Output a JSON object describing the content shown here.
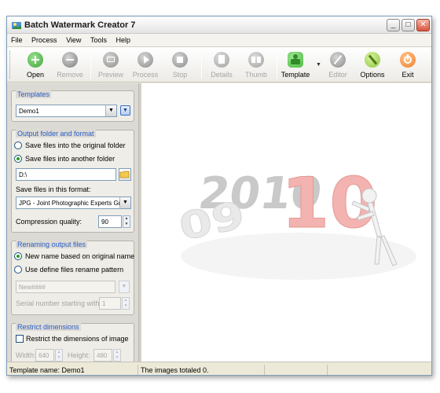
{
  "window": {
    "title": "Batch Watermark Creator 7",
    "controls": {
      "minimize": "_",
      "maximize": "□",
      "close": "✕"
    }
  },
  "menu": [
    "File",
    "Process",
    "View",
    "Tools",
    "Help"
  ],
  "toolbar": {
    "open": {
      "label": "Open",
      "icon": "plus-icon",
      "color": "#3fa53a"
    },
    "remove": {
      "label": "Remove",
      "icon": "minus-icon",
      "color": "#8a8a8a"
    },
    "preview": {
      "label": "Preview",
      "icon": "camera-icon",
      "color": "#9a9a9a"
    },
    "process": {
      "label": "Process",
      "icon": "play-icon",
      "color": "#9a9a9a"
    },
    "stop": {
      "label": "Stop",
      "icon": "stop-icon",
      "color": "#9a9a9a"
    },
    "details": {
      "label": "Details",
      "icon": "document-icon",
      "color": "#a8a8a8"
    },
    "thumb": {
      "label": "Thumb",
      "icon": "thumbnails-icon",
      "color": "#a8a8a8"
    },
    "template": {
      "label": "Template",
      "icon": "puzzle-icon",
      "color": "#46b93b"
    },
    "editor": {
      "label": "Editor",
      "icon": "pencil-icon",
      "color": "#9a9a9a"
    },
    "options": {
      "label": "Options",
      "icon": "wrench-icon",
      "color": "#8cc63e"
    },
    "exit": {
      "label": "Exit",
      "icon": "power-icon",
      "color": "#f07d2a"
    }
  },
  "templates": {
    "title": "Templates",
    "selected": "Demo1"
  },
  "output": {
    "title": "Output folder and format",
    "opt_original": "Save files into the original folder",
    "opt_another": "Save files into another folder",
    "folder": "D:\\",
    "format_label": "Save files in this format:",
    "format": "JPG - Joint Photographic Experts Gr",
    "quality_label": "Compression quality:",
    "quality": "90"
  },
  "renaming": {
    "title": "Renaming output files",
    "opt_new_name": "New name based on original name",
    "opt_pattern": "Use define files rename pattern",
    "pattern": "New####",
    "serial_label": "Serial number starting with",
    "serial": "1"
  },
  "dimensions": {
    "title": "Restrict dimensions",
    "check_label": "Restrict the dimensions of image",
    "width_label": "Width:",
    "width": "640",
    "height_label": "Height:",
    "height": "480"
  },
  "status": {
    "template": "Template name: Demo1",
    "images": "The images totaled 0."
  },
  "preview_art": {
    "top": "2010",
    "bottom": "09"
  }
}
